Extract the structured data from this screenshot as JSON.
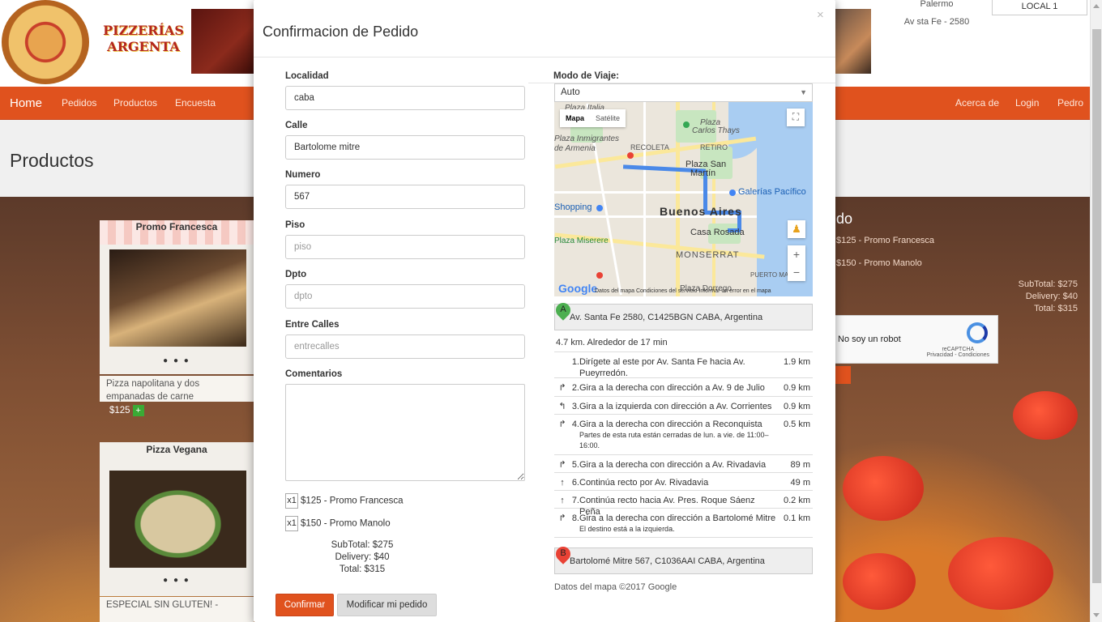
{
  "site": {
    "logo_text": "PIZZERÍAS ARGENTA",
    "local_info_1": "Palermo",
    "local_info_2": "Av sta Fe - 2580",
    "local_button": "LOCAL 1",
    "page_title": "Productos"
  },
  "nav": {
    "brand": "Home",
    "items": [
      "Pedidos",
      "Productos",
      "Encuesta"
    ],
    "right_items": [
      "Acerca de",
      "Login",
      "Pedro"
    ]
  },
  "background_cards": [
    {
      "title": "Promo Francesca",
      "dots": "● ● ●",
      "description": "Pizza napolitana y dos empanadas de carne",
      "price": "$125",
      "plus": "+"
    },
    {
      "title": "Pizza Vegana",
      "dots": "● ● ●",
      "description": "ESPECIAL SIN GLUTEN! -"
    }
  ],
  "background_cart": {
    "title_fragment": "do",
    "line_1": "$125 - Promo Francesca",
    "line_2": "$150 - Promo Manolo",
    "subtotal": "SubTotal: $275",
    "delivery": "Delivery: $40",
    "total": "Total: $315",
    "recaptcha_label": "No soy un robot",
    "recaptcha_brand": "reCAPTCHA",
    "recaptcha_terms": "Privacidad - Condiciones"
  },
  "modal": {
    "title": "Confirmacion de Pedido",
    "close": "×",
    "fields": {
      "localidad": {
        "label": "Localidad",
        "value": "caba",
        "placeholder": ""
      },
      "calle": {
        "label": "Calle",
        "value": "Bartolome mitre",
        "placeholder": ""
      },
      "numero": {
        "label": "Numero",
        "value": "567",
        "placeholder": ""
      },
      "piso": {
        "label": "Piso",
        "value": "",
        "placeholder": "piso"
      },
      "dpto": {
        "label": "Dpto",
        "value": "",
        "placeholder": "dpto"
      },
      "entre_calles": {
        "label": "Entre Calles",
        "value": "",
        "placeholder": "entrecalles"
      },
      "comentarios": {
        "label": "Comentarios"
      }
    },
    "order_items": [
      {
        "qty": "x1",
        "text": "$125 - Promo Francesca"
      },
      {
        "qty": "x1",
        "text": "$150 - Promo Manolo"
      }
    ],
    "subtotal": "SubTotal: $275",
    "delivery": "Delivery: $40",
    "total": "Total: $315",
    "confirm_button": "Confirmar",
    "modify_button": "Modificar mi pedido",
    "travel_mode": {
      "label": "Modo de Viaje:",
      "value": "Auto",
      "arrow": "▼"
    },
    "map": {
      "type_map": "Mapa",
      "type_satellite": "Satélite",
      "fullscreen": "⛶",
      "pegman": "♟",
      "zoom_in": "+",
      "zoom_out": "−",
      "google": "Google",
      "footer": "Datos del mapa   Condiciones del servicio   Informar un error en el mapa",
      "labels": {
        "italia": "Plaza Italia",
        "carlos": "Plaza",
        "carlos2": "Carlos Thays",
        "inmigrantes": "Plaza Inmigrantes",
        "armenia": "de Armenia",
        "recoleta": "RECOLETA",
        "retiro": "RETIRO",
        "sanmartin": "Plaza San",
        "sanmartin2": "Martín",
        "galerias": "Galerías Pacífico",
        "shopping": "Shopping",
        "city": "Buenos Aires",
        "miserere": "Plaza Miserere",
        "rosada": "Casa Rosada",
        "monserrat": "MONSERRAT",
        "madero": "PUERTO MA",
        "dorrego": "Plaza Dorrego"
      }
    },
    "origin": {
      "letter": "A",
      "address": "Av. Santa Fe 2580, C1425BGN CABA, Argentina"
    },
    "summary": "4.7 km. Alrededor de 17 min",
    "steps": [
      {
        "icon": "",
        "num": "1.",
        "text": "Dirígete al este por Av. Santa Fe hacia Av. Pueyrredón.",
        "note": "",
        "dist": "1.9 km"
      },
      {
        "icon": "↱",
        "num": "2.",
        "text": "Gira a la derecha con dirección a Av. 9 de Julio",
        "note": "",
        "dist": "0.9 km"
      },
      {
        "icon": "↰",
        "num": "3.",
        "text": "Gira a la izquierda con dirección a Av. Corrientes",
        "note": "",
        "dist": "0.9 km"
      },
      {
        "icon": "↱",
        "num": "4.",
        "text": "Gira a la derecha con dirección a Reconquista",
        "note": "Partes de esta ruta están cerradas de lun. a vie. de 11:00–16:00.",
        "dist": "0.5 km"
      },
      {
        "icon": "↱",
        "num": "5.",
        "text": "Gira a la derecha con dirección a Av. Rivadavia",
        "note": "",
        "dist": "89 m"
      },
      {
        "icon": "↑",
        "num": "6.",
        "text": "Continúa recto por Av. Rivadavia",
        "note": "",
        "dist": "49 m"
      },
      {
        "icon": "↑",
        "num": "7.",
        "text": "Continúa recto hacia Av. Pres. Roque Sáenz Peña",
        "note": "",
        "dist": "0.2 km"
      },
      {
        "icon": "↱",
        "num": "8.",
        "text": "Gira a la derecha con dirección a Bartolomé Mitre",
        "note": "El destino está a la izquierda.",
        "dist": "0.1 km"
      }
    ],
    "destination": {
      "letter": "B",
      "address": "Bartolomé Mitre 567, C1036AAI CABA, Argentina"
    },
    "map_credit": "Datos del mapa ©2017 Google"
  },
  "colors": {
    "accent": "#e0521e",
    "route": "#4a89e8",
    "marker_a": "#4caf50",
    "marker_b": "#e94235"
  }
}
